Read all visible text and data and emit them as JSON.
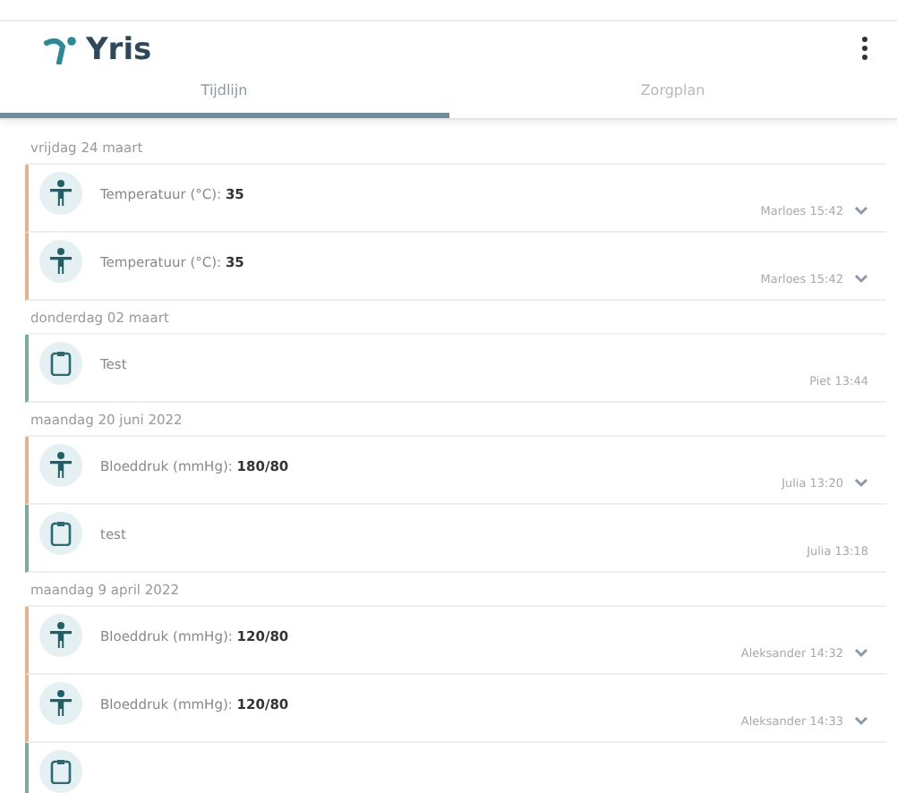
{
  "app": {
    "title": "Yris"
  },
  "tabs": [
    {
      "label": "Tijdlijn",
      "selected": true
    },
    {
      "label": "Zorgplan",
      "selected": false
    }
  ],
  "timeline": [
    {
      "date": "vrijdag 24 maart",
      "entries": [
        {
          "kind": "vital",
          "text": "Temperatuur (°C): **35**",
          "time": "Marloes 15:42"
        },
        {
          "kind": "vital",
          "text": "Temperatuur (°C): **35**",
          "time": "Marloes 15:42"
        }
      ]
    },
    {
      "date": "donderdag 02 maart",
      "entries": [
        {
          "kind": "note",
          "text": "Test",
          "time": "Piet 13:44"
        }
      ]
    },
    {
      "date": "maandag 20 juni 2022",
      "entries": [
        {
          "kind": "vital",
          "text": "Bloeddruk (mmHg): **180/80**",
          "time": "Julia 13:20"
        },
        {
          "kind": "note",
          "text": "test",
          "time": "Julia 13:18"
        }
      ]
    },
    {
      "date": "maandag 9 april 2022",
      "entries": [
        {
          "kind": "vital",
          "text": "Bloeddruk (mmHg): **120/80**",
          "time": "Aleksander 14:32"
        },
        {
          "kind": "vital",
          "text": "Bloeddruk (mmHg): **120/80**",
          "time": "Aleksander 14:33"
        },
        {
          "kind": "note"
        }
      ]
    }
  ]
}
